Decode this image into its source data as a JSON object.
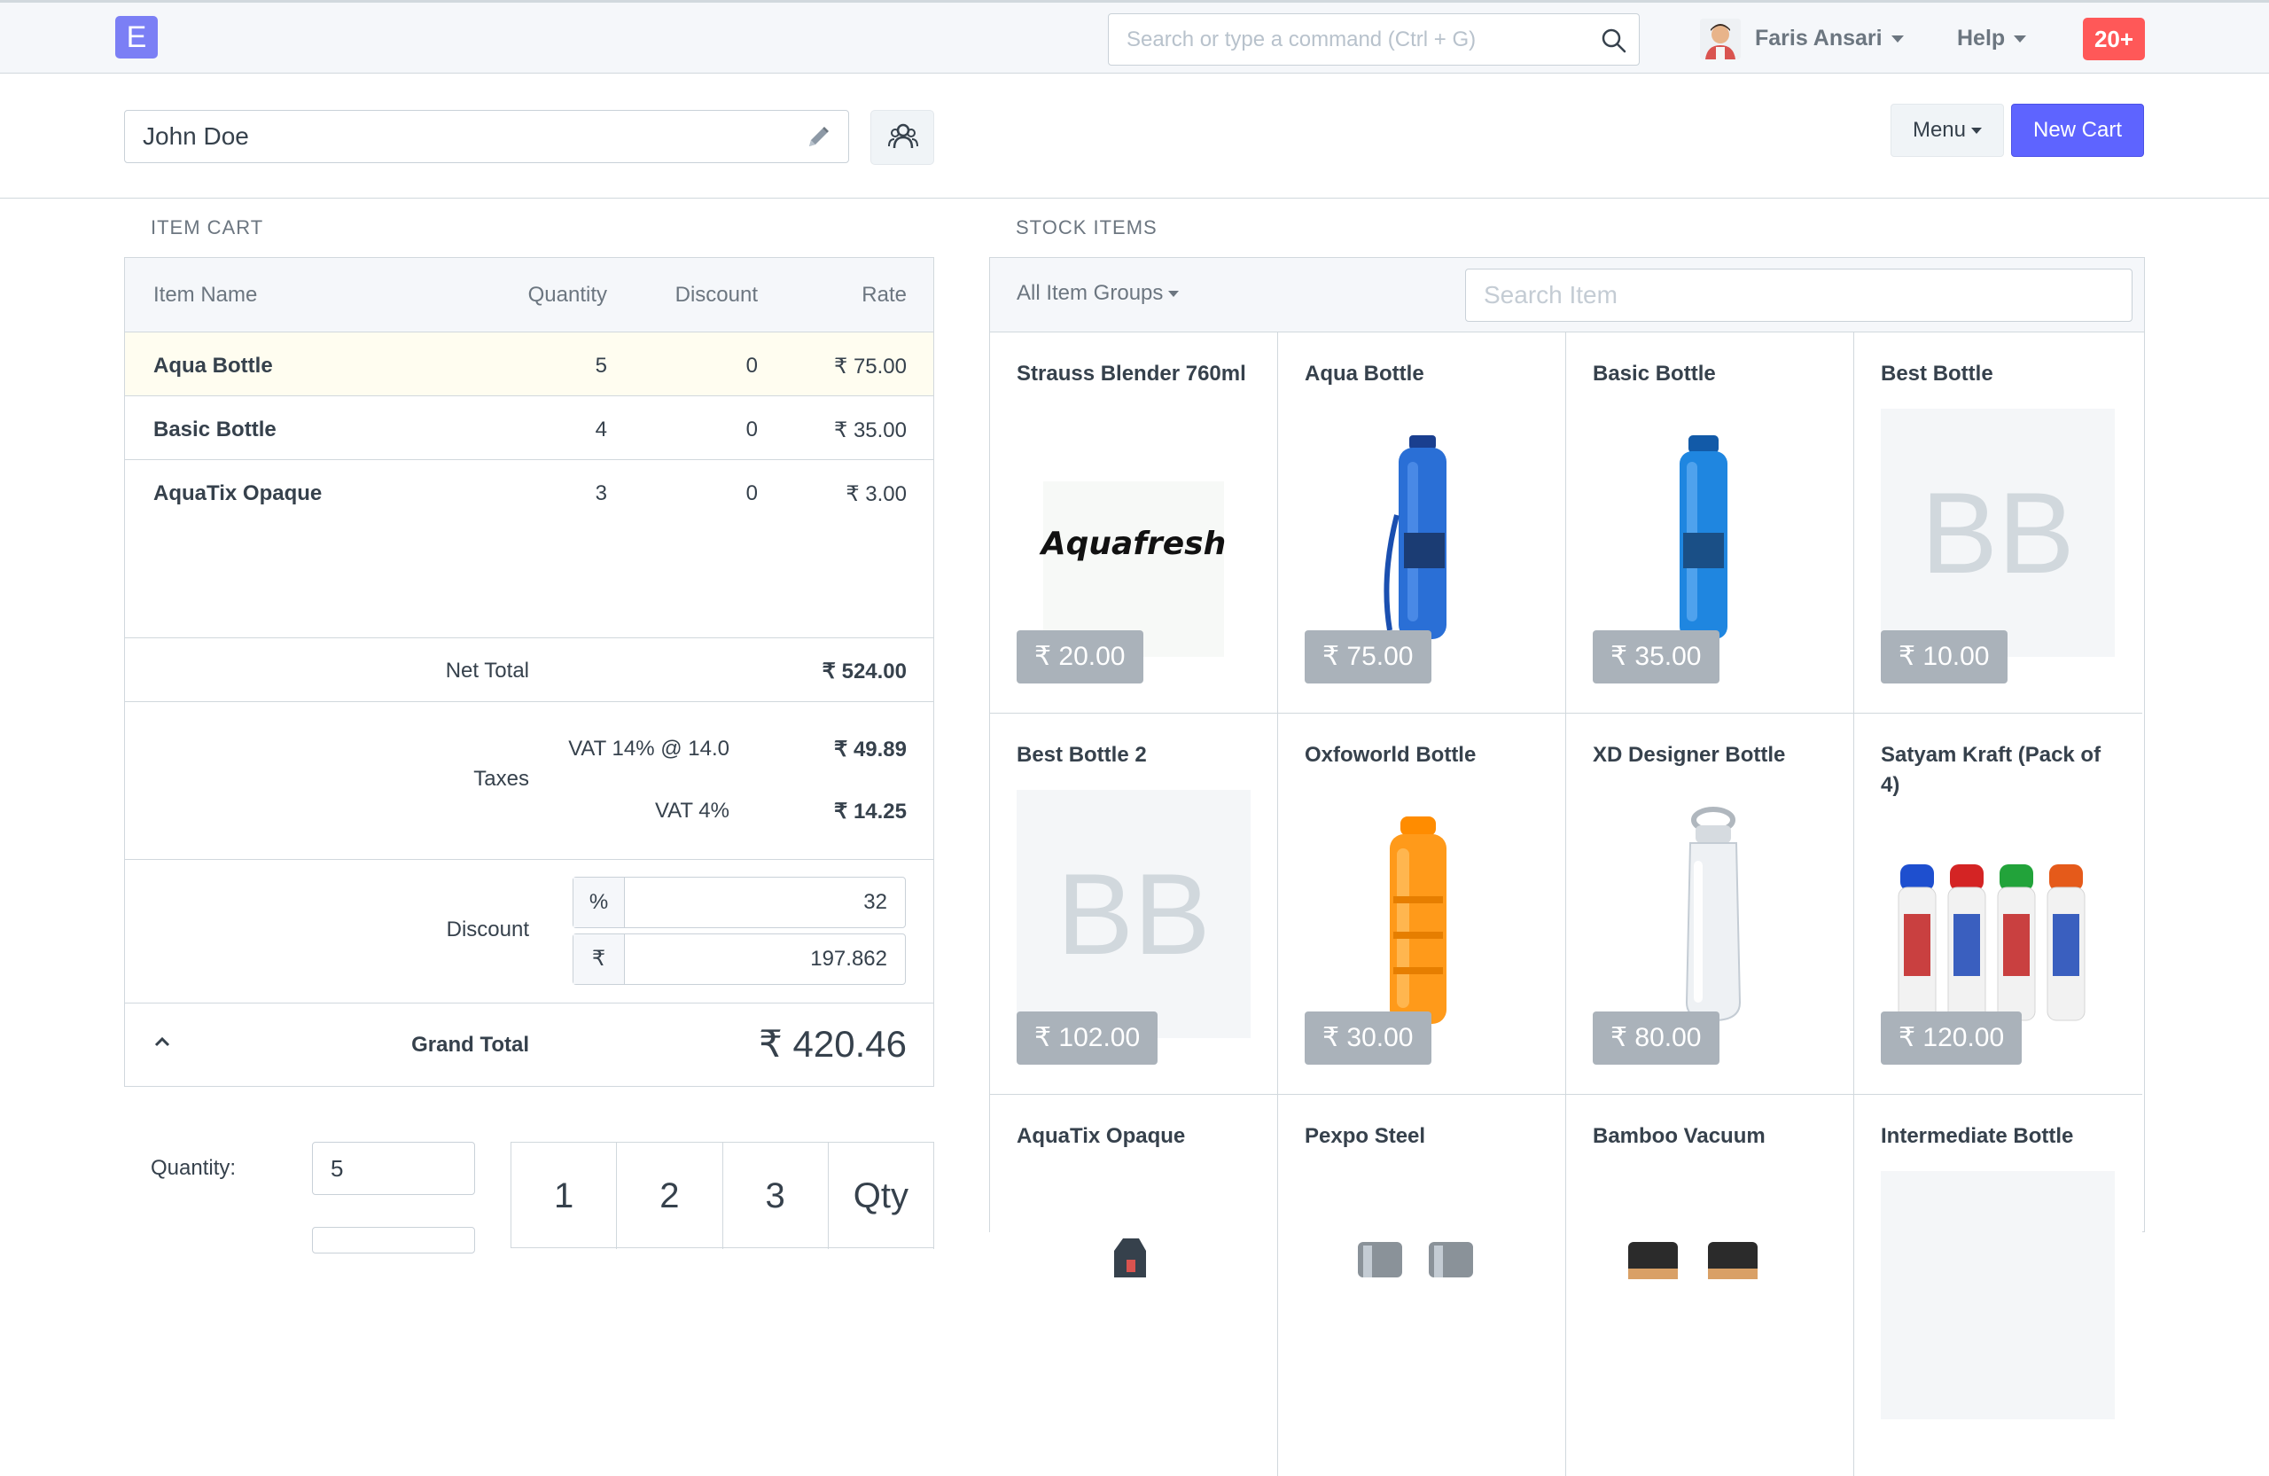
{
  "navbar": {
    "logo_letter": "E",
    "search_placeholder": "Search or type a command (Ctrl + G)",
    "user_name": "Faris Ansari",
    "help_label": "Help",
    "notifications": "20+"
  },
  "page_head": {
    "customer": "John Doe",
    "menu_label": "Menu",
    "new_cart_label": "New Cart"
  },
  "cart": {
    "section_title": "ITEM CART",
    "headers": {
      "name": "Item Name",
      "quantity": "Quantity",
      "discount": "Discount",
      "rate": "Rate"
    },
    "rows": [
      {
        "name": "Aqua Bottle",
        "quantity": "5",
        "discount": "0",
        "rate": "₹ 75.00"
      },
      {
        "name": "Basic Bottle",
        "quantity": "4",
        "discount": "0",
        "rate": "₹ 35.00"
      },
      {
        "name": "AquaTix Opaque",
        "quantity": "3",
        "discount": "0",
        "rate": "₹ 3.00"
      }
    ],
    "net_total_label": "Net Total",
    "net_total": "₹ 524.00",
    "taxes_label": "Taxes",
    "taxes": [
      {
        "name": "VAT 14% @ 14.0",
        "amount": "₹ 49.89"
      },
      {
        "name": "VAT 4%",
        "amount": "₹ 14.25"
      }
    ],
    "discount_label": "Discount",
    "discount_percent_symbol": "%",
    "discount_percent": "32",
    "discount_amount_symbol": "₹",
    "discount_amount": "197.862",
    "grand_total_label": "Grand Total",
    "grand_total": "₹ 420.46",
    "quantity_label": "Quantity:",
    "quantity_value": "5",
    "numpad": [
      "1",
      "2",
      "3",
      "Qty"
    ]
  },
  "stock": {
    "section_title": "STOCK ITEMS",
    "item_group": "All Item Groups",
    "search_placeholder": "Search Item",
    "items": [
      {
        "name": "Strauss Blender 760ml",
        "price": "₹ 20.00",
        "image": "aquafresh-logo",
        "logo_text": "Aquafresh"
      },
      {
        "name": "Aqua Bottle",
        "price": "₹ 75.00",
        "image": "blue-bottle",
        "color": "#2a6fd6"
      },
      {
        "name": "Basic Bottle",
        "price": "₹ 35.00",
        "image": "blue-bottle",
        "color": "#1f86e0"
      },
      {
        "name": "Best Bottle",
        "price": "₹ 10.00",
        "image": "abbr",
        "abbr": "BB"
      },
      {
        "name": "Best Bottle 2",
        "price": "₹ 102.00",
        "image": "abbr",
        "abbr": "BB"
      },
      {
        "name": "Oxfoworld Bottle",
        "price": "₹ 30.00",
        "image": "orange-bottle",
        "color": "#ff9a1a"
      },
      {
        "name": "XD Designer Bottle",
        "price": "₹ 80.00",
        "image": "clear-bottle"
      },
      {
        "name": "Satyam Kraft (Pack of 4)",
        "price": "₹ 120.00",
        "image": "bottle-pack"
      },
      {
        "name": "AquaTix Opaque",
        "image": "partial"
      },
      {
        "name": "Pexpo Steel",
        "image": "partial"
      },
      {
        "name": "Bamboo Vacuum",
        "image": "partial"
      },
      {
        "name": "Intermediate Bottle",
        "image": "partial"
      }
    ]
  },
  "colors": {
    "primary": "#5e64ff",
    "badge": "#ff5858",
    "price_tag": "#aab2ba",
    "active_row": "#fffdf0"
  }
}
